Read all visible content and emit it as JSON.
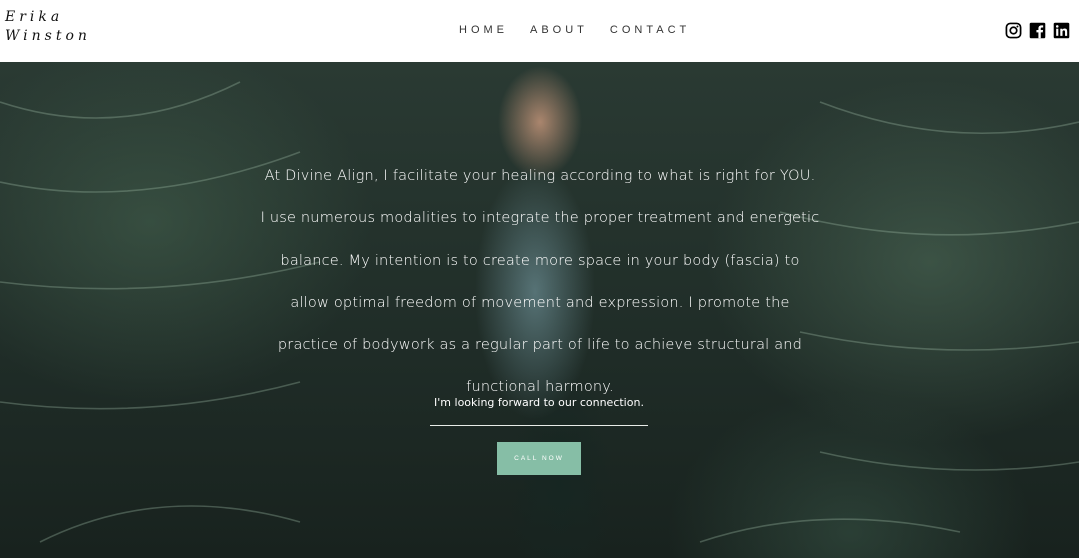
{
  "brand": {
    "line1": "Erika",
    "line2": "Winston"
  },
  "nav": {
    "items": [
      "HOME",
      "ABOUT",
      "CONTACT"
    ]
  },
  "social": {
    "icons": [
      "instagram-icon",
      "facebook-icon",
      "linkedin-icon"
    ]
  },
  "hero": {
    "paragraph": "At Divine Align, I facilitate your healing according to what is right for YOU. I use numerous modalities to integrate the proper treatment and energetic balance. My intention is to create more space in your body (fascia) to allow optimal freedom of movement and expression. I promote the practice of bodywork as a regular part of life to achieve structural and functional harmony.",
    "subtext": "I'm looking forward to our connection.",
    "cta_label": "CALL NOW"
  },
  "colors": {
    "accent": "#86bea6",
    "header_bg": "#ffffff",
    "text_dark": "#111111"
  }
}
